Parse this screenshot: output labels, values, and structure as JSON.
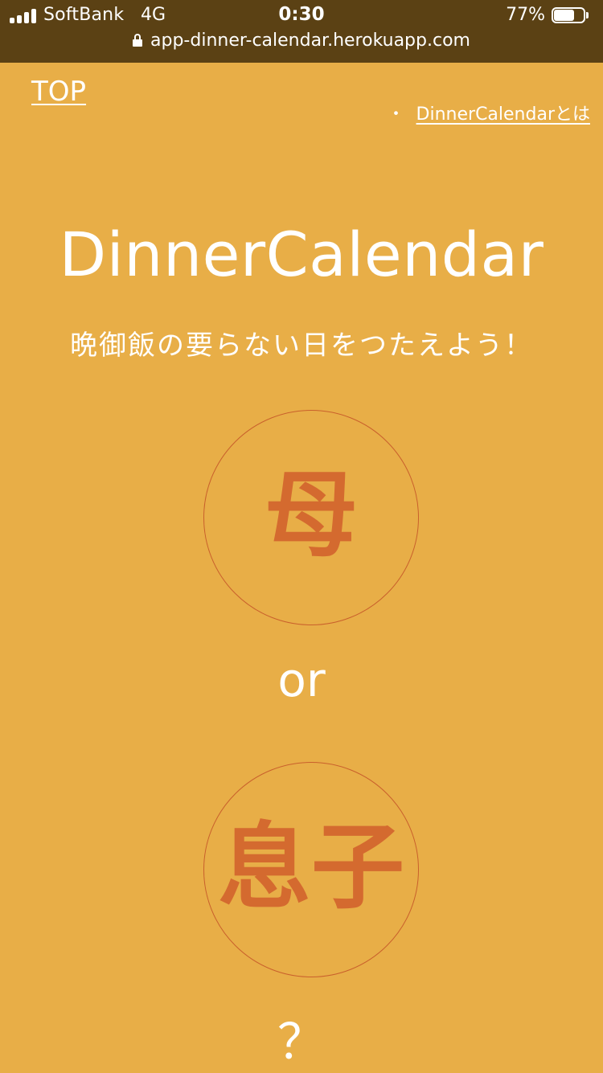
{
  "status_bar": {
    "carrier": "SoftBank",
    "network": "4G",
    "time": "0:30",
    "battery_percent": "77%",
    "battery_level": 0.77,
    "signal_bars": 4
  },
  "browser": {
    "url": "app-dinner-calendar.herokuapp.com",
    "secure_icon": "lock-icon"
  },
  "nav": {
    "top_link": "TOP",
    "bullet": "・",
    "about_link": "DinnerCalendarとは"
  },
  "hero": {
    "title": "DinnerCalendar",
    "subtitle": "晩御飯の要らない日をつたえよう！"
  },
  "roles": {
    "mother_label": "母",
    "or_label": "or",
    "son_label": "息子",
    "question": "？"
  },
  "colors": {
    "background": "#E8AE47",
    "status_bar": "#5B4114",
    "accent": "#D46A2F",
    "text": "#FFFFFF"
  }
}
